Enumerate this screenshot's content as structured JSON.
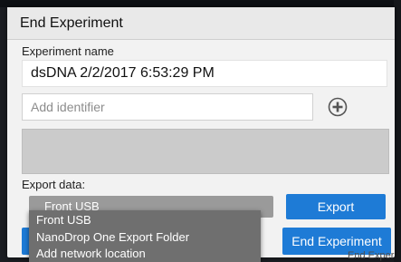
{
  "dialog": {
    "title": "End Experiment",
    "experiment_name_label": "Experiment name",
    "experiment_name_value": "dsDNA 2/2/2017 6:53:29 PM",
    "identifier_placeholder": "Add identifier",
    "add_icon": "plus-circle-icon",
    "export_label": "Export data:",
    "export_select_value": "Front USB",
    "export_button": "Export",
    "end_button": "End Experiment"
  },
  "dropdown": {
    "items": [
      "Front USB",
      "NanoDrop One Export Folder",
      "Add network location"
    ]
  },
  "background_text": "End Exper",
  "colors": {
    "primary": "#1e7bd6",
    "select_bg": "#9a9a9a",
    "dropdown_bg": "#6f6f6f",
    "dialog_bg": "#f2f2f2"
  }
}
